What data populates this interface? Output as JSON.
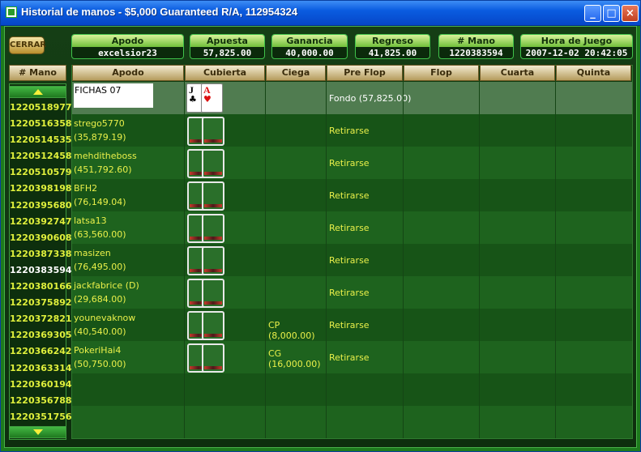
{
  "window": {
    "title": "Historial de manos - $5,000 Guaranteed R/A, 112954324"
  },
  "buttons": {
    "cerrar": "CERRAR",
    "minimize": "_",
    "maximize": "□",
    "close": "×"
  },
  "info": [
    {
      "label": "Apodo",
      "value": "excelsior23"
    },
    {
      "label": "Apuesta",
      "value": "57,825.00"
    },
    {
      "label": "Ganancia",
      "value": "40,000.00"
    },
    {
      "label": "Regreso",
      "value": "41,825.00"
    },
    {
      "label": "# Mano",
      "value": "1220383594"
    },
    {
      "label": "Hora de Juego",
      "value": "2007-12-02 20:42:05"
    }
  ],
  "hand_list": {
    "header": "# Mano",
    "items": [
      "1220518977",
      "1220516358",
      "1220514535",
      "1220512458",
      "1220510579",
      "1220398198",
      "1220395680",
      "1220392747",
      "1220390608",
      "1220387338",
      "1220383594",
      "1220380166",
      "1220375892",
      "1220372821",
      "1220369305",
      "1220366242",
      "1220363314",
      "1220360194",
      "1220356788",
      "1220351756"
    ],
    "selected": "1220383594"
  },
  "table": {
    "columns": [
      "Apodo",
      "Cubierta",
      "Ciega",
      "Pre Flop",
      "Flop",
      "Cuarta",
      "Quinta"
    ],
    "rows": [
      {
        "name": "FICHAS 07",
        "stack": "",
        "cards": [
          {
            "rank": "J",
            "suit": "♣"
          },
          {
            "rank": "A",
            "suit": "♥"
          }
        ],
        "blind": "",
        "preflop": "Fondo (57,825.00)"
      },
      {
        "name": "strego5770",
        "stack": "(35,879.19)",
        "blind": "",
        "preflop": "Retirarse"
      },
      {
        "name": "mehditheboss",
        "stack": "(451,792.60)",
        "blind": "",
        "preflop": "Retirarse"
      },
      {
        "name": "BFH2",
        "stack": "(76,149.04)",
        "blind": "",
        "preflop": "Retirarse"
      },
      {
        "name": "latsa13",
        "stack": "(63,560.00)",
        "blind": "",
        "preflop": "Retirarse"
      },
      {
        "name": "masizen",
        "stack": "(76,495.00)",
        "blind": "",
        "preflop": "Retirarse"
      },
      {
        "name": "jackfabrice (D)",
        "stack": "(29,684.00)",
        "blind": "",
        "preflop": "Retirarse"
      },
      {
        "name": "younevaknow",
        "stack": "(40,540.00)",
        "blind": "CP (8,000.00)",
        "preflop": "Retirarse"
      },
      {
        "name": "PokeriHai4",
        "stack": "(50,750.00)",
        "blind": "CG (16,000.00)",
        "preflop": "Retirarse"
      }
    ]
  },
  "colors": {
    "accent": "#e0f03c",
    "title_bar": "#0a5ce0",
    "panel_green": "#1e631e"
  }
}
